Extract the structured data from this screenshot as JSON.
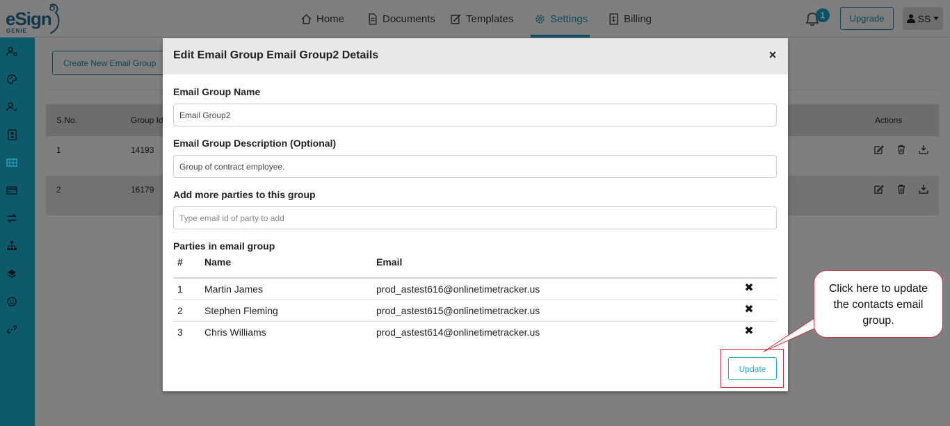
{
  "brand": {
    "logo_text": "eSign",
    "logo_sub": "GENIE"
  },
  "nav": [
    {
      "label": "Home",
      "icon": "home-icon"
    },
    {
      "label": "Documents",
      "icon": "document-icon"
    },
    {
      "label": "Templates",
      "icon": "template-icon"
    },
    {
      "label": "Settings",
      "icon": "gear-icon",
      "active": true
    },
    {
      "label": "Billing",
      "icon": "billing-icon"
    }
  ],
  "header": {
    "notification_count": "1",
    "upgrade_label": "Upgrade",
    "user_initials": "SS"
  },
  "page": {
    "create_button_label": "Create New Email Group",
    "table_headers": {
      "sno": "S.No.",
      "group_id": "Group Id",
      "actions": "Actions"
    },
    "rows": [
      {
        "sno": "1",
        "group_id": "14193"
      },
      {
        "sno": "2",
        "group_id": "16179"
      }
    ]
  },
  "modal": {
    "title": "Edit Email Group Email Group2 Details",
    "close_symbol": "×",
    "name_label": "Email Group Name",
    "name_value": "Email Group2",
    "description_label": "Email Group Description (Optional)",
    "description_value": "Group of contract employee.",
    "add_label": "Add more parties to this group",
    "add_placeholder": "Type email id of party to add",
    "parties_label": "Parties in email group",
    "columns": {
      "num": "#",
      "name": "Name",
      "email": "Email"
    },
    "parties": [
      {
        "num": "1",
        "name": "Martin James",
        "email": "prod_astest616@onlinetimetracker.us"
      },
      {
        "num": "2",
        "name": "Stephen Fleming",
        "email": "prod_astest615@onlinetimetracker.us"
      },
      {
        "num": "3",
        "name": "Chris Williams",
        "email": "prod_astest614@onlinetimetracker.us"
      }
    ],
    "remove_symbol": "✖",
    "update_label": "Update"
  },
  "annotation": {
    "callout_text": "Click here to update the contacts email group."
  },
  "colors": {
    "accent": "#2aa8c7",
    "sidebar": "#0d5a6c",
    "overlay": "#7f7f7f",
    "callout_border": "#c23a3a"
  }
}
